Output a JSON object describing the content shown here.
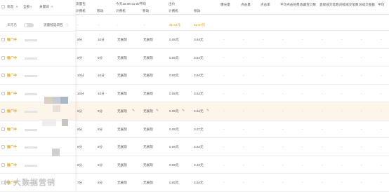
{
  "header": {
    "status": "状态",
    "all": "全部",
    "ad_plan": "关键词",
    "group_total": "流量包",
    "billing_method": "计费机",
    "bid_floor": "移动",
    "time_label": "今天10:08-21:00平均",
    "billing_machine": "计费机",
    "mobile": "移动",
    "bid_price": "出价",
    "bid_billing": "计费机",
    "bid_mobile": "移动",
    "exposure": "曝光量",
    "clicks": "点击量",
    "ctr": "点击率",
    "avg_cpc": "平均点击花费",
    "collect_bao": "收藏宝贝数",
    "direct_deal": "直接成交笔数",
    "indirect_deal": "间接成交笔数",
    "total_deal": "总成交金额",
    "avg": "平均"
  },
  "summary_row": {
    "label": "未开启",
    "flow_label": "流量智选词包",
    "c1": "-",
    "c2": "-",
    "c3": "-",
    "c4": "-",
    "money1": "¥1.64元",
    "money2": "¥2.87元"
  },
  "rows": [
    {
      "status": "推广中",
      "billing": "9分",
      "mobile": "10分",
      "v1": "无展现",
      "v2": "无展现",
      "p1": "0.05元",
      "p2": "3.64元"
    },
    {
      "status": "推广中",
      "billing": "9分",
      "mobile": "9分",
      "v1": "无展现",
      "v2": "无展现",
      "p1": "0.05元",
      "p2": "3.64元"
    },
    {
      "status": "推广中",
      "billing": "10分",
      "mobile": "10分",
      "v1": "无展现",
      "v2": "无展现",
      "p1": "0.05元",
      "p2": "3.64元"
    },
    {
      "status": "推广中",
      "billing": "10分",
      "mobile": "10分",
      "v1": "无展现",
      "v2": "无展现",
      "p1": "0.05元",
      "p2": "3.64元"
    },
    {
      "status": "推广中",
      "billing": "9分",
      "mobile": "9分",
      "v1": "无展现",
      "v2": "无展现",
      "p1": "0.05元",
      "p2": "3.64元"
    },
    {
      "status": "推广中",
      "billing": "8分",
      "mobile": "8分",
      "v1": "无展现",
      "v2": "无展现",
      "p1": "0.05元",
      "p2": "3.07元"
    },
    {
      "status": "推广中",
      "billing": "8分",
      "mobile": "9分",
      "v1": "无展现",
      "v2": "无展现",
      "p1": "0.05元",
      "p2": "3.64元"
    },
    {
      "status": "推广中",
      "billing": "9分",
      "mobile": "8分",
      "v1": "无展现",
      "v2": "无展现",
      "p1": "0.05元",
      "p2": "3.46元"
    },
    {
      "status": "推广中",
      "billing": "7分",
      "mobile": "8分",
      "v1": "无展现",
      "v2": "无展现",
      "p1": "0.05元",
      "p2": "3.64元"
    }
  ],
  "dash": "-",
  "watermark": "K 大数据营销",
  "colors": {
    "accent": "#e8a000",
    "highlight_row": "#fdf4ea"
  }
}
